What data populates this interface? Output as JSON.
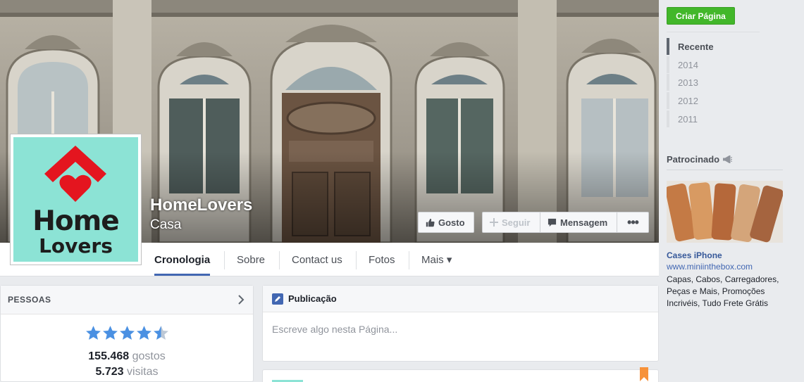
{
  "page": {
    "name": "HomeLovers",
    "category": "Casa",
    "logo_text_top": "Home",
    "logo_text_bottom": "Lovers"
  },
  "cover_actions": {
    "like": "Gosto",
    "follow": "Seguir",
    "message": "Mensagem",
    "more": "•••"
  },
  "nav": {
    "tabs": [
      {
        "label": "Cronologia",
        "active": true
      },
      {
        "label": "Sobre"
      },
      {
        "label": "Contact us"
      },
      {
        "label": "Fotos"
      },
      {
        "label": "Mais ▾"
      }
    ]
  },
  "people": {
    "title": "PESSOAS",
    "rating_stars": 4.5,
    "likes_value": "155.468",
    "likes_label": "gostos",
    "visits_value": "5.723",
    "visits_label": "visitas"
  },
  "composer": {
    "tab_label": "Publicação",
    "placeholder": "Escreve algo nesta Página..."
  },
  "sidebar": {
    "create_page": "Criar Página",
    "years": [
      {
        "label": "Recente",
        "active": true
      },
      {
        "label": "2014"
      },
      {
        "label": "2013"
      },
      {
        "label": "2012"
      },
      {
        "label": "2011"
      }
    ],
    "sponsored_label": "Patrocinado",
    "ad": {
      "title": "Cases iPhone",
      "url": "www.miniinthebox.com",
      "text": "Capas, Cabos, Carregadores, Peças e Mais, Promoções Incrivéis, Tudo Frete Grátis"
    }
  },
  "colors": {
    "accent_blue": "#4267b2",
    "create_green": "#42b72a",
    "logo_bg": "#8ce3d5",
    "logo_red": "#e4151f",
    "star_blue": "#4a90e2"
  }
}
